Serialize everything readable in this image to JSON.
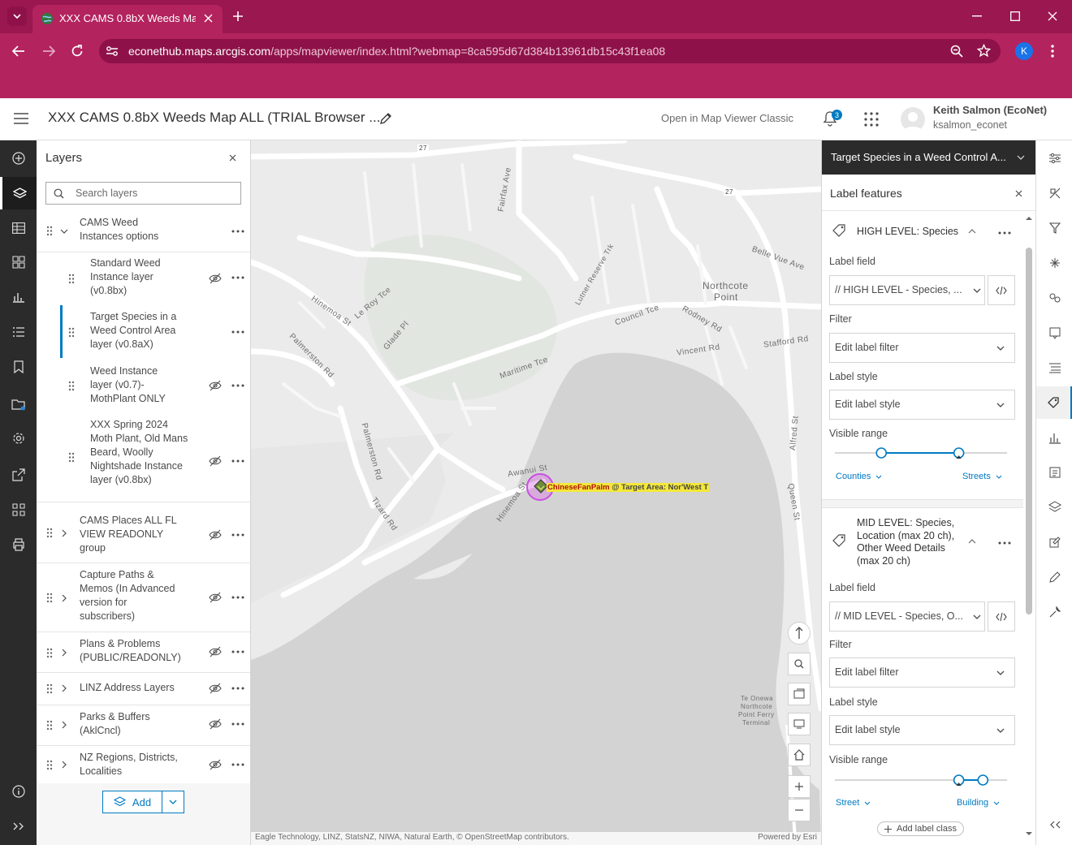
{
  "browser": {
    "tab_title": "XXX CAMS 0.8bX Weeds Map A",
    "url_domain": "econethub.maps.arcgis.com",
    "url_path": "/apps/mapviewer/index.html?webmap=8ca595d67d384b13961db15c43f1ea08",
    "profile_initial": "K",
    "accent": "#b3235e"
  },
  "header": {
    "title": "XXX CAMS 0.8bX Weeds Map ALL (TRIAL Browser ...",
    "open_classic": "Open in Map Viewer Classic",
    "notification_count": "3",
    "user_name": "Keith Salmon (EcoNet)",
    "user_id": "ksalmon_econet"
  },
  "layers": {
    "title": "Layers",
    "search_placeholder": "Search layers",
    "group_title": "CAMS Weed Instances options",
    "sublayers": [
      {
        "label": "Standard Weed Instance layer (v0.8bx)"
      },
      {
        "label": "Target Species in a Weed Control Area layer (v0.8aX)"
      },
      {
        "label": "Weed Instance layer (v0.7)- MothPlant ONLY"
      },
      {
        "label": "XXX Spring 2024 Moth Plant, Old Mans Beard, Woolly Nightshade Instance layer (v0.8bx)"
      }
    ],
    "groups": [
      {
        "label": "CAMS Places ALL FL VIEW READONLY group"
      },
      {
        "label": "Capture Paths & Memos (In Advanced version for subscribers)"
      },
      {
        "label": "Plans & Problems (PUBLIC/READONLY)"
      },
      {
        "label": "LINZ Address Layers"
      },
      {
        "label": "Parks & Buffers (AklCncl)"
      },
      {
        "label": "NZ Regions, Districts, Localities"
      }
    ],
    "add_label": "Add"
  },
  "map": {
    "streets": [
      "27",
      "27",
      "Fairfax Ave",
      "Lutner Reserve Trk",
      "Belle Vue Ave",
      "Northcote",
      "Point",
      "Hinemoa St",
      "Le Roy Tce",
      "Glade Pl",
      "Council Tce",
      "Rodney Rd",
      "Palmerston Rd",
      "Maritime Tce",
      "Vincent Rd",
      "Stafford Rd",
      "Alfred St",
      "Palmerston Rd",
      "Awanui St",
      "Hinemoa St",
      "Queen St",
      "Tizard Rd",
      "Te Onewa",
      "Northcote",
      "Point Ferry",
      "Terminal"
    ],
    "feature_label": "ChineseFanPalm",
    "feature_label_suffix": " @ Target Area: Nor'West T",
    "attribution": "Eagle Technology, LINZ, StatsNZ, NIWA, Natural Earth, © OpenStreetMap contributors.",
    "powered_by": "Powered by Esri"
  },
  "right_panel": {
    "layer_name": "Target Species in a Weed Control A...",
    "title": "Label features",
    "classes": [
      {
        "name": "HIGH LEVEL: Species",
        "label_field_title": "Label field",
        "label_field_value": "// HIGH LEVEL - Species, ...",
        "filter_title": "Filter",
        "filter_value": "Edit label filter",
        "style_title": "Label style",
        "style_value": "Edit label style",
        "range_title": "Visible range",
        "range_min": "Counties",
        "range_max": "Streets",
        "range_min_frac": 0.27,
        "range_max_frac": 0.72
      },
      {
        "name": "MID LEVEL: Species, Location (max 20 ch), Other Weed Details (max 20 ch)",
        "label_field_title": "Label field",
        "label_field_value": "// MID LEVEL - Species, O...",
        "filter_title": "Filter",
        "filter_value": "Edit label filter",
        "style_title": "Label style",
        "style_value": "Edit label style",
        "range_title": "Visible range",
        "range_min": "Street",
        "range_max": "Building",
        "range_min_frac": 0.72,
        "range_max_frac": 0.86
      }
    ],
    "add_label_class": "Add label class"
  }
}
